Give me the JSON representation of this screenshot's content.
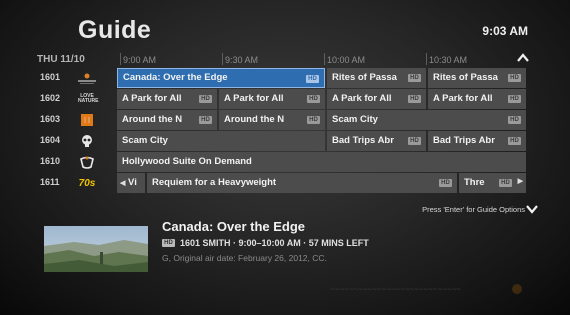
{
  "header": {
    "title": "Guide",
    "clock": "9:03 AM"
  },
  "timebar": {
    "date": "THU 11/10",
    "times": [
      "9:00 AM",
      "9:30 AM",
      "10:00 AM",
      "10:30 AM"
    ]
  },
  "rows": [
    {
      "channel": "1601",
      "logo": "travel-channel-logo",
      "cells": [
        {
          "title": "Canada: Over the Edge",
          "hd": "HD",
          "selected": true
        },
        {
          "title": "Rites of Passa",
          "hd": "HD"
        },
        {
          "title": "Rites of Passa",
          "hd": "HD"
        }
      ]
    },
    {
      "channel": "1602",
      "logo_text": "LOVE NATURE",
      "cells": [
        {
          "title": "A Park for All",
          "hd": "HD"
        },
        {
          "title": "A Park for All",
          "hd": "HD"
        },
        {
          "title": "A Park for All",
          "hd": "HD"
        },
        {
          "title": "A Park for All",
          "hd": "HD"
        }
      ]
    },
    {
      "channel": "1603",
      "logo": "orange-channel-logo",
      "cells": [
        {
          "title": "Around the N",
          "hd": "HD"
        },
        {
          "title": "Around the N",
          "hd": "HD"
        },
        {
          "title": "Scam City",
          "hd": "HD"
        }
      ]
    },
    {
      "channel": "1604",
      "logo": "skull-channel-logo",
      "cells": [
        {
          "title": "Scam City",
          "hd": ""
        },
        {
          "title": "Bad Trips Abr",
          "hd": "HD"
        },
        {
          "title": "Bad Trips Abr",
          "hd": "HD"
        }
      ]
    },
    {
      "channel": "1610",
      "logo": "hollywood-suite-logo",
      "cells": [
        {
          "title": "Hollywood Suite On Demand",
          "hd": ""
        }
      ]
    },
    {
      "channel": "1611",
      "logo_text": "70s",
      "cells": [
        {
          "title": "Vi",
          "hd": ""
        },
        {
          "title": "Requiem for a Heavyweight",
          "hd": "HD"
        },
        {
          "title": "Thre",
          "hd": "HD"
        }
      ]
    }
  ],
  "hint": "Press 'Enter' for Guide Options",
  "info": {
    "title": "Canada: Over the Edge",
    "hd": "HD",
    "details": "1601 SMITH  ·  9:00–10:00 AM  ·  57 MINS LEFT",
    "description": "G, Original air date: February 26, 2012, CC."
  }
}
